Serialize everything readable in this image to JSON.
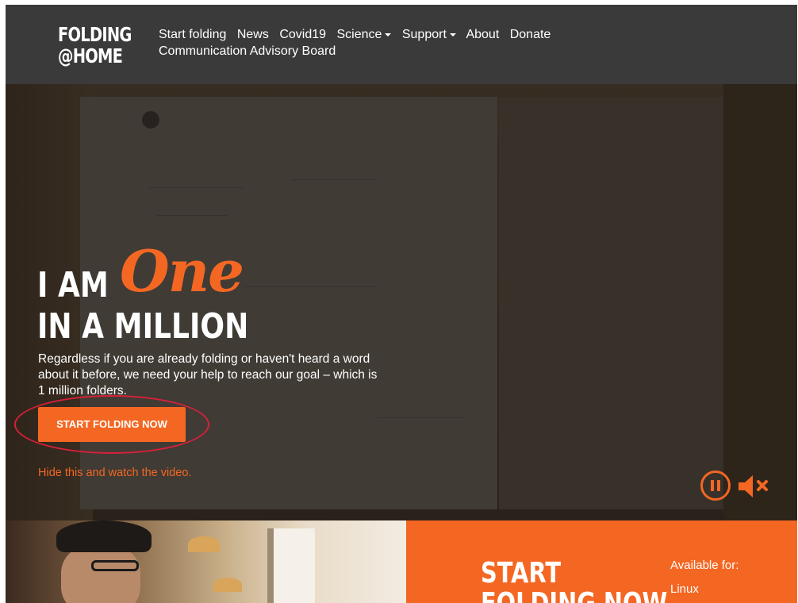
{
  "logo": {
    "line1": "FOLDING",
    "line2": "@HOME"
  },
  "nav": {
    "items": [
      "Start folding",
      "News",
      "Covid19",
      "Science",
      "Support",
      "About",
      "Donate",
      "Communication Advisory Board"
    ]
  },
  "hero": {
    "headline_i_am": "I AM",
    "headline_one": "One",
    "headline_million": "IN A MILLION",
    "tagline": "Regardless if you are already folding or haven't heard a word about it before, we need your help to reach our goal – which is 1 million folders.",
    "cta": "START FOLDING NOW",
    "hide_link": "Hide this and watch the video."
  },
  "bottom": {
    "heading_line1": "START",
    "heading_line2": "FOLDING NOW",
    "available_label": "Available for:",
    "os_first": "Linux"
  },
  "colors": {
    "accent": "#f46723",
    "nav_bg": "#3a3a3a",
    "annotation": "#d9203a"
  },
  "icons": [
    "pause-icon",
    "mute-icon",
    "caret-down-icon"
  ]
}
